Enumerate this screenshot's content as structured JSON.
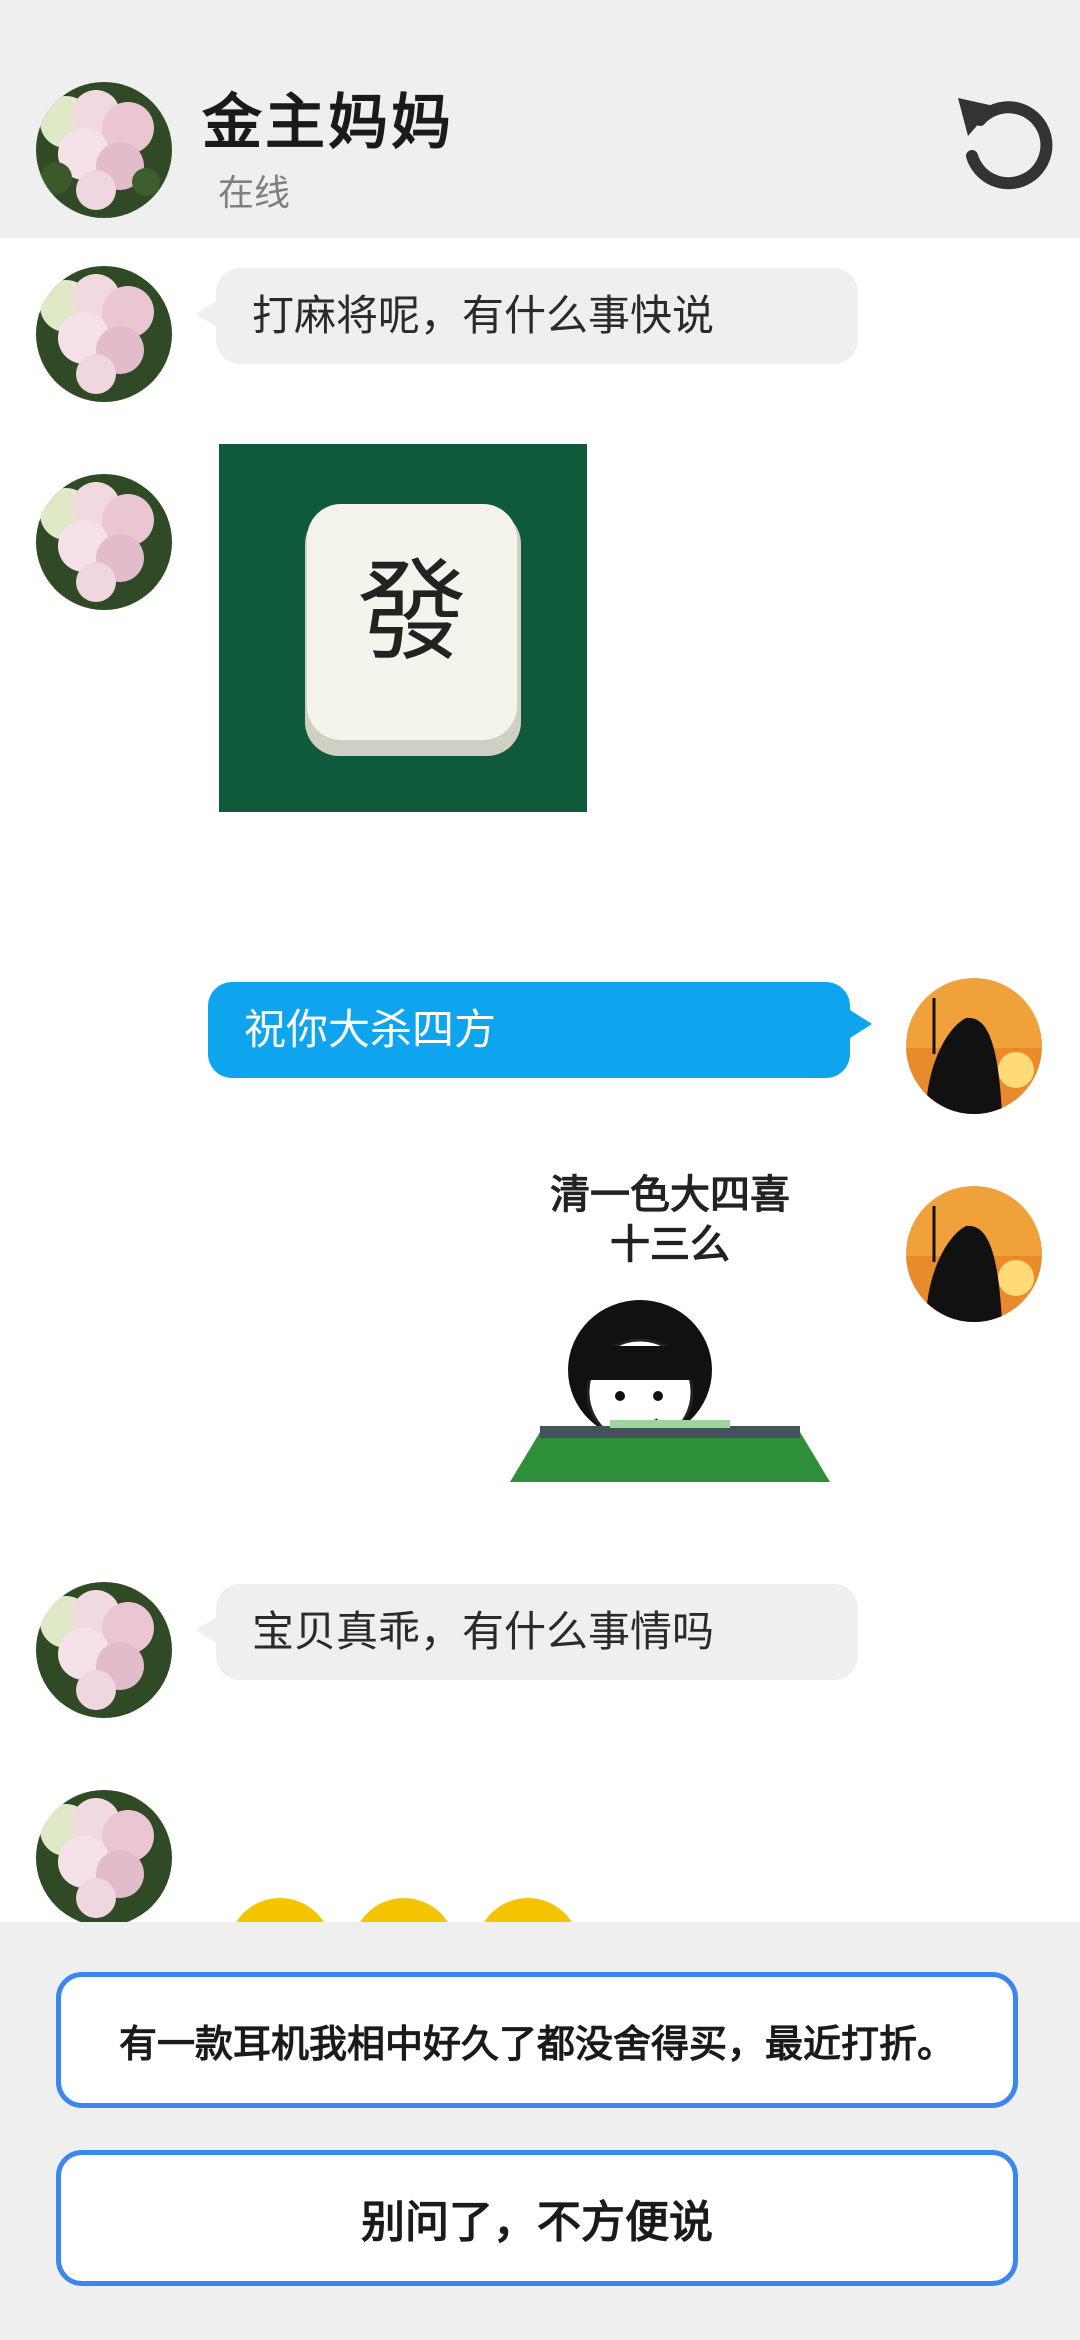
{
  "header": {
    "contact_name": "金主妈妈",
    "status": "在线",
    "refresh_icon": "refresh-icon"
  },
  "messages": [
    {
      "side": "left",
      "type": "text",
      "text": "打麻将呢，有什么事快说"
    },
    {
      "side": "left",
      "type": "image",
      "image": "mahjong-fa-tile-photo",
      "tile_char": "發"
    },
    {
      "side": "right",
      "type": "text",
      "text": "祝你大杀四方"
    },
    {
      "side": "right",
      "type": "sticker",
      "line1": "清一色大四喜",
      "line2": "十三么"
    },
    {
      "side": "left",
      "type": "text",
      "text": "宝贝真乖，有什么事情吗"
    },
    {
      "side": "left",
      "type": "emoji",
      "emoji": "yellow-emoji-faces"
    }
  ],
  "reply_options": [
    {
      "label": "有一款耳机我相中好久了都没舍得买，最近打折。"
    },
    {
      "label": "别问了，不方便说"
    }
  ],
  "colors": {
    "header_bg": "#efefef",
    "sent_bubble": "#0ea5ee",
    "received_bubble": "#efefef",
    "option_border": "#3c86f0"
  }
}
